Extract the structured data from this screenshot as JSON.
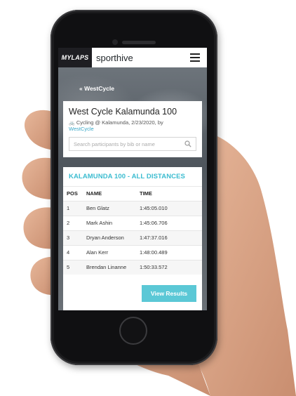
{
  "app": {
    "logo": "MYLAPS",
    "brand": "sporthive"
  },
  "nav": {
    "back_label": "« WestCycle"
  },
  "event": {
    "title": "West Cycle Kalamunda 100",
    "meta": "Cycling @ Kalamunda, 2/23/2020, by",
    "organizer": "WestCycle"
  },
  "search": {
    "placeholder": "Search participants by bib or name",
    "value": ""
  },
  "results": {
    "header": "KALAMUNDA 100 - ALL DISTANCES",
    "columns": [
      "POS",
      "NAME",
      "TIME"
    ],
    "rows": [
      {
        "pos": "1",
        "name": "Ben Glatz",
        "time": "1:45:05.010"
      },
      {
        "pos": "2",
        "name": "Mark Ashin",
        "time": "1:45:06.706"
      },
      {
        "pos": "3",
        "name": "Dryan Anderson",
        "time": "1:47:37.016"
      },
      {
        "pos": "4",
        "name": "Alan Kerr",
        "time": "1:48:00.489"
      },
      {
        "pos": "5",
        "name": "Brendan Linanne",
        "time": "1:50:33.572"
      }
    ],
    "button_label": "View Results"
  },
  "colors": {
    "accent": "#3bbcd0",
    "button": "#5bc8d6",
    "link": "#3aa8c8"
  }
}
